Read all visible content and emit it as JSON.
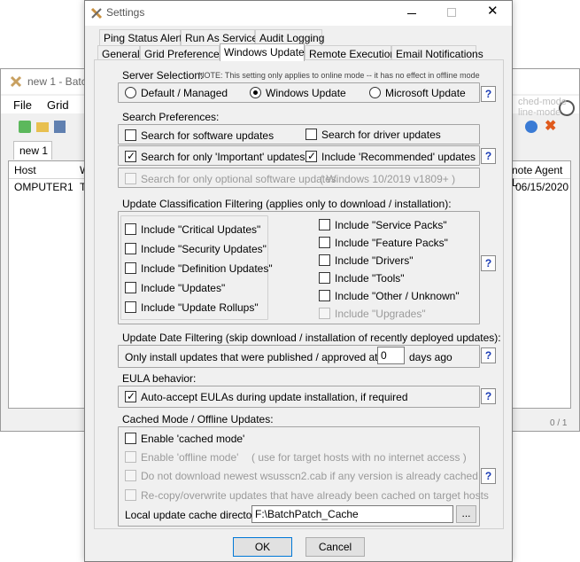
{
  "background_window": {
    "title": "new 1 - Batch",
    "menu": [
      "File",
      "Grid"
    ],
    "tab_label": "new 1",
    "grid_headers": [
      "Host",
      "W"
    ],
    "grid_headers_right": "note Agent L",
    "grid_row": {
      "host": "OMPUTER1",
      "col2": "Th",
      "date": "06/15/2020"
    },
    "right_faded": [
      "ched-mode",
      "line-mode"
    ],
    "status_count": "0 / 1"
  },
  "dialog": {
    "title": "Settings",
    "tabs_row1": [
      "Ping Status Alerts",
      "Run As Service",
      "Audit Logging"
    ],
    "tabs_row2": [
      "General",
      "Grid Preferences",
      "Windows Update",
      "Remote Execution",
      "Email Notifications"
    ],
    "active_tab": "Windows Update",
    "server_selection": {
      "label": "Server Selection:",
      "note": "NOTE: This setting only applies to online mode -- it has no effect in offline mode",
      "options": [
        "Default / Managed",
        "Windows Update",
        "Microsoft Update"
      ],
      "selected": "Windows Update"
    },
    "search_prefs": {
      "label": "Search Preferences:",
      "software": "Search for software updates",
      "drivers": "Search for driver updates",
      "important": "Search for only 'Important' updates",
      "recommended": "Include 'Recommended' updates",
      "optional": "Search for only optional software updates",
      "optional_note": "( Windows 10/2019 v1809+ )"
    },
    "classification": {
      "label": "Update Classification Filtering (applies only to download / installation):",
      "left": [
        "Include \"Critical Updates\"",
        "Include \"Security Updates\"",
        "Include \"Definition Updates\"",
        "Include \"Updates\"",
        "Include \"Update Rollups\""
      ],
      "right": [
        "Include \"Service Packs\"",
        "Include \"Feature Packs\"",
        "Include \"Drivers\"",
        "Include \"Tools\"",
        "Include \"Other / Unknown\"",
        "Include \"Upgrades\""
      ]
    },
    "date_filter": {
      "label": "Update Date Filtering (skip download / installation of recently deployed updates):",
      "text_before": "Only install updates that were published / approved at least",
      "value": "0",
      "text_after": "days ago"
    },
    "eula": {
      "label": "EULA behavior:",
      "checkbox": "Auto-accept EULAs during update installation, if required"
    },
    "cached": {
      "label": "Cached Mode / Offline Updates:",
      "enable_cached": "Enable 'cached mode'",
      "enable_offline": "Enable 'offline mode'",
      "offline_note": "( use for target hosts with no internet access )",
      "no_download": "Do not download newest wsusscn2.cab if any version is already cached",
      "recopy": "Re-copy/overwrite updates that have already been cached on target hosts",
      "dir_label": "Local update cache directory:",
      "dir_value": "F:\\BatchPatch_Cache",
      "browse": "..."
    },
    "help": "?",
    "ok": "OK",
    "cancel": "Cancel"
  }
}
